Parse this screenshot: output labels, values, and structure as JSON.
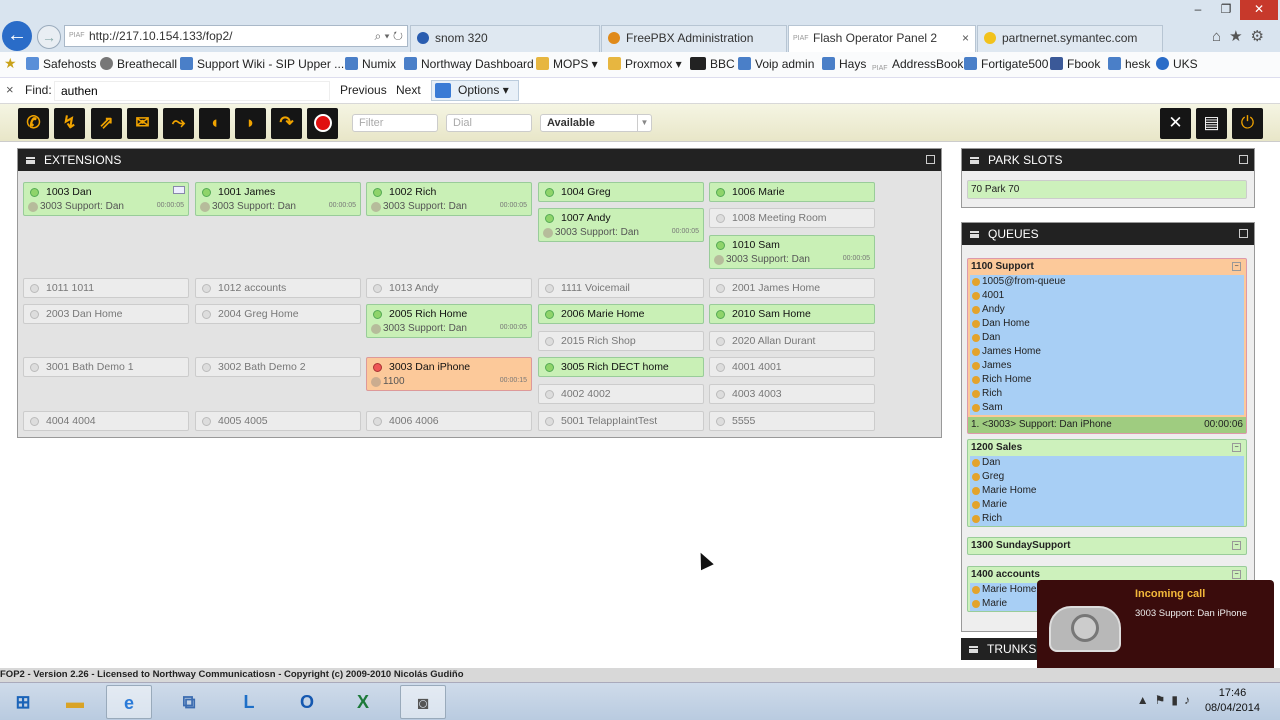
{
  "browser": {
    "url": "http://217.10.154.133/fop2/",
    "url_tag": "PIAF",
    "tabs": [
      {
        "label": "snom 320",
        "active": false
      },
      {
        "label": "FreePBX Administration",
        "active": false
      },
      {
        "label": "Flash Operator Panel 2",
        "active": true,
        "tag": "PIAF"
      },
      {
        "label": "partnernet.symantec.com",
        "active": false
      }
    ],
    "favorites": [
      "Safehosts",
      "Breathecall",
      "Support Wiki - SIP Upper ...",
      "Numix",
      "Northway Dashboard",
      "MOPS",
      "Proxmox",
      "BBC",
      "Voip admin",
      "Hays",
      "AddressBook",
      "Fortigate500",
      "Fbook",
      "hesk",
      "UKS"
    ],
    "fav_tag_addressbook": "PIAF",
    "find": {
      "label": "Find:",
      "value": "authen",
      "previous": "Previous",
      "next": "Next",
      "options": "Options"
    }
  },
  "toolbar": {
    "filter_placeholder": "Filter",
    "dial_placeholder": "Dial",
    "status": "Available"
  },
  "extensions": {
    "title": "Extensions",
    "items": [
      {
        "label": "1003 Dan",
        "state": "active",
        "sub": "3003 Support: Dan",
        "time": "00:00:05"
      },
      {
        "label": "1001 James",
        "state": "active",
        "sub": "3003 Support: Dan",
        "time": "00:00:05"
      },
      {
        "label": "1002 Rich",
        "state": "active",
        "sub": "3003 Support: Dan",
        "time": "00:00:05"
      },
      {
        "label": "1004 Greg",
        "state": "active"
      },
      {
        "label": "1006 Marie",
        "state": "active"
      },
      {
        "label": "1007 Andy",
        "state": "active",
        "sub": "3003 Support: Dan",
        "time": "00:00:05"
      },
      {
        "label": "1008 Meeting Room",
        "state": "idle"
      },
      {
        "label": "1010 Sam",
        "state": "active",
        "sub": "3003 Support: Dan",
        "time": "00:00:05"
      },
      {
        "label": "1011 1011",
        "state": "idle"
      },
      {
        "label": "1012 accounts",
        "state": "idle"
      },
      {
        "label": "1013 Andy",
        "state": "idle"
      },
      {
        "label": "1111 Voicemail",
        "state": "idle"
      },
      {
        "label": "2001 James Home",
        "state": "idle"
      },
      {
        "label": "2003 Dan Home",
        "state": "idle"
      },
      {
        "label": "2004 Greg Home",
        "state": "idle"
      },
      {
        "label": "2005 Rich Home",
        "state": "active",
        "sub": "3003 Support: Dan",
        "time": "00:00:05"
      },
      {
        "label": "2006 Marie Home",
        "state": "active"
      },
      {
        "label": "2010 Sam Home",
        "state": "active"
      },
      {
        "label": "2015 Rich Shop",
        "state": "idle"
      },
      {
        "label": "2020 Allan Durant",
        "state": "idle"
      },
      {
        "label": "3001 Bath Demo 1",
        "state": "idle"
      },
      {
        "label": "3002 Bath Demo 2",
        "state": "idle"
      },
      {
        "label": "3003 Dan iPhone",
        "state": "ringing",
        "sub": "1100",
        "time": "00:00:15"
      },
      {
        "label": "3005 Rich DECT home",
        "state": "active"
      },
      {
        "label": "4001 4001",
        "state": "idle"
      },
      {
        "label": "4002 4002",
        "state": "idle"
      },
      {
        "label": "4003 4003",
        "state": "idle"
      },
      {
        "label": "4004 4004",
        "state": "idle"
      },
      {
        "label": "4005 4005",
        "state": "idle"
      },
      {
        "label": "4006 4006",
        "state": "idle"
      },
      {
        "label": "5001 TelappIaintTest",
        "state": "idle"
      },
      {
        "label": "5555",
        "state": "idle"
      }
    ]
  },
  "park": {
    "title": "Park Slots",
    "slot": "70 Park 70"
  },
  "queues": {
    "title": "Queues",
    "items": [
      {
        "name": "1100 Support",
        "members": [
          "1005@from-queue",
          "4001",
          "Andy",
          "Dan Home",
          "Dan",
          "James Home",
          "James",
          "Rich Home",
          "Rich",
          "Sam"
        ],
        "call": "1. <3003> Support: Dan iPhone",
        "call_time": "00:00:06"
      },
      {
        "name": "1200 Sales",
        "members": [
          "Dan",
          "Greg",
          "Marie Home",
          "Marie",
          "Rich"
        ]
      },
      {
        "name": "1300 SundaySupport",
        "members": []
      },
      {
        "name": "1400 accounts",
        "members": [
          "Marie Home",
          "Marie"
        ]
      }
    ]
  },
  "trunks": {
    "title": "Trunks"
  },
  "popup": {
    "title": "Incoming call",
    "message": "3003 Support: Dan iPhone"
  },
  "footer": "FOP2 - Version 2.26 - Licensed to Northway Communicatiosn - Copyright (c) 2009-2010 Nicolás Gudiño",
  "taskbar": {
    "time": "17:46",
    "date": "08/04/2014"
  },
  "colors": {
    "active": "#c9f0b6",
    "ringing": "#fcc99a",
    "queue_member_bg": "#a8cff5",
    "header": "#222222",
    "toolbar_icon": "#f0a300"
  }
}
